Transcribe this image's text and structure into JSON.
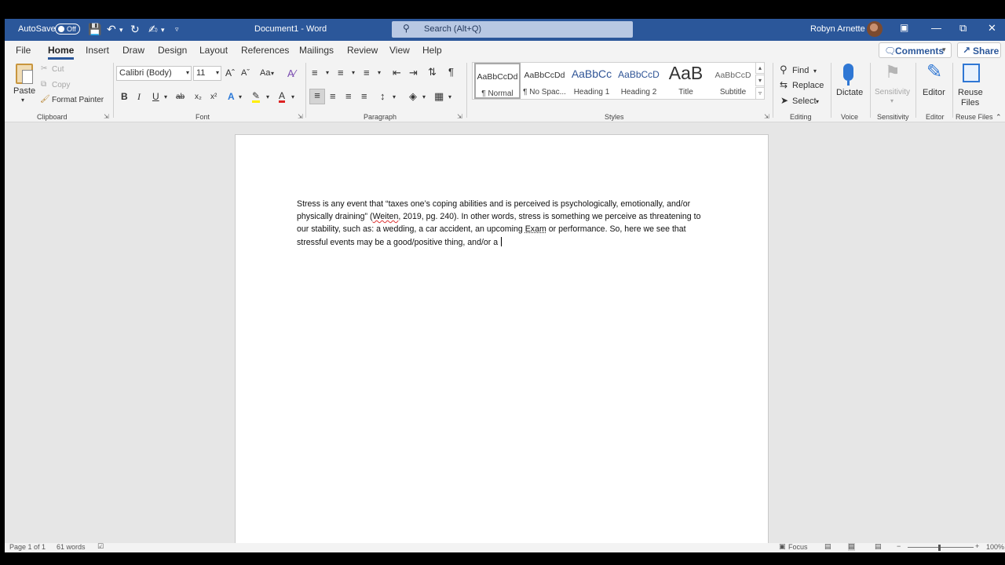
{
  "titlebar": {
    "autosave_label": "AutoSave",
    "autosave_state": "Off",
    "doc_title": "Document1  -  Word",
    "search_placeholder": "Search (Alt+Q)",
    "user_name": "Robyn Arnette"
  },
  "tabs": [
    "File",
    "Home",
    "Insert",
    "Draw",
    "Design",
    "Layout",
    "References",
    "Mailings",
    "Review",
    "View",
    "Help"
  ],
  "tab_active": "Home",
  "comments_label": "Comments",
  "share_label": "Share",
  "clipboard": {
    "paste": "Paste",
    "cut": "Cut",
    "copy": "Copy",
    "format_painter": "Format Painter",
    "label": "Clipboard"
  },
  "font": {
    "name": "Calibri (Body)",
    "size": "11",
    "label": "Font",
    "case_label": "Aa",
    "bold": "B",
    "italic": "I",
    "underline": "U",
    "strike": "ab",
    "sub": "x₂",
    "sup": "x²"
  },
  "paragraph": {
    "label": "Paragraph"
  },
  "styles": {
    "label": "Styles",
    "items": [
      {
        "sample": "AaBbCcDd",
        "name": "¶ Normal"
      },
      {
        "sample": "AaBbCcDd",
        "name": "¶ No Spac..."
      },
      {
        "sample": "AaBbCc",
        "name": "Heading 1"
      },
      {
        "sample": "AaBbCcD",
        "name": "Heading 2"
      },
      {
        "sample": "AaB",
        "name": "Title"
      },
      {
        "sample": "AaBbCcD",
        "name": "Subtitle"
      }
    ]
  },
  "editing": {
    "find": "Find",
    "replace": "Replace",
    "select": "Select",
    "label": "Editing"
  },
  "voice": {
    "dictate": "Dictate",
    "label": "Voice"
  },
  "sensitivity": {
    "button": "Sensitivity",
    "label": "Sensitivity"
  },
  "editor": {
    "button": "Editor",
    "label": "Editor"
  },
  "reuse": {
    "button_line1": "Reuse",
    "button_line2": "Files",
    "label": "Reuse Files"
  },
  "document": {
    "seg1": "Stress is any event that “taxes one’s coping abilities and is perceived is psychologically, emotionally, and/or physically draining” (",
    "seg2": "Weiten",
    "seg3": ", 2019, pg. 240).  In other words, stress is something we perceive as threatening to our stability, such as: a wedding, a car accident, an upcoming ",
    "seg4": "Exam",
    "seg5": " or performance.  So, here we see that stressful events may be a good/positive thing, and/or a "
  },
  "status": {
    "page": "Page 1 of 1",
    "words": "61 words",
    "focus": "Focus",
    "zoom": "100%"
  },
  "colors": {
    "titlebar": "#2b579a",
    "ribbon": "#f3f3f3",
    "canvas": "#e6e6e6"
  }
}
